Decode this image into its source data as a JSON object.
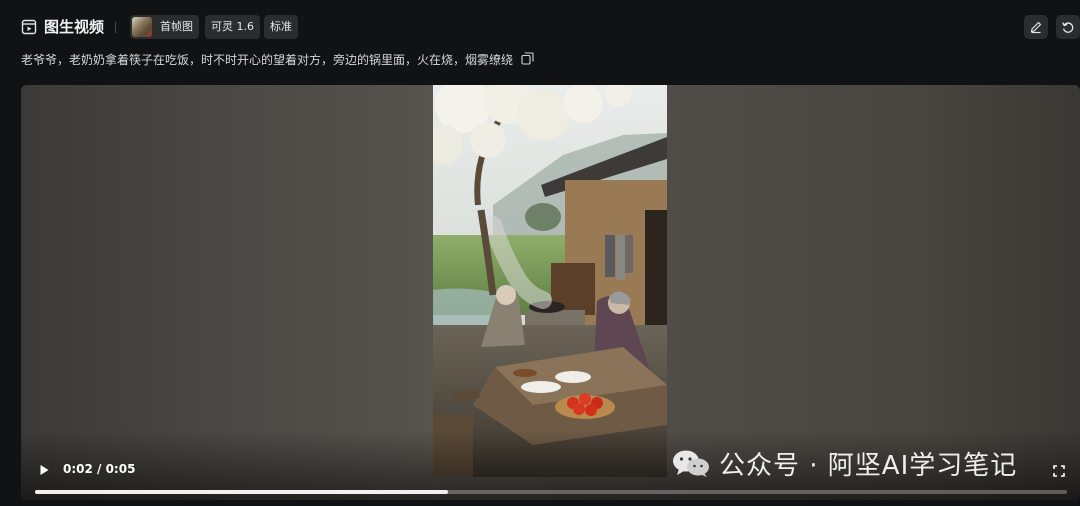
{
  "header": {
    "title": "图生视频",
    "tags": {
      "mode": "首帧图",
      "model": "可灵 1.6",
      "quality": "标准"
    }
  },
  "prompt": {
    "text": "老爷爷，老奶奶拿着筷子在吃饭，时不时开心的望着对方，旁边的锅里面，火在烧，烟雾缭绕"
  },
  "player": {
    "time": "0:02 / 0:05",
    "progress": 0.4
  },
  "watermark": {
    "text": "公众号 · 阿坚AI学习笔记"
  },
  "icons": {
    "title": "video-frame-icon",
    "edit": "pencil-icon",
    "undo": "undo-icon",
    "copy": "copy-icon",
    "play": "play-icon",
    "fullscreen": "fullscreen-icon",
    "watermark": "wechat-icon"
  }
}
